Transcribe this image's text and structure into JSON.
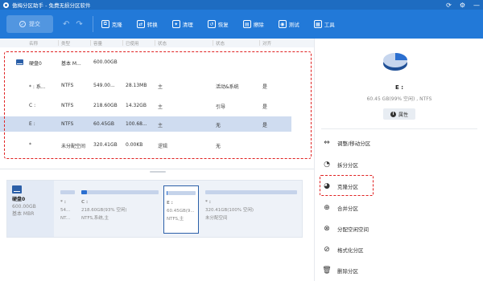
{
  "app": {
    "title": "傲梅分区助手 - 免费无损分区软件",
    "window_buttons": [
      "⟳",
      "⚙",
      "—"
    ]
  },
  "toolbar": {
    "commit_label": "提交",
    "items": [
      {
        "label": "克隆",
        "icon": "clone-icon"
      },
      {
        "label": "转换",
        "icon": "convert-icon"
      },
      {
        "label": "清理",
        "icon": "clean-icon"
      },
      {
        "label": "恢复",
        "icon": "recover-icon"
      },
      {
        "label": "擦除",
        "icon": "wipe-icon"
      },
      {
        "label": "测试",
        "icon": "test-icon"
      },
      {
        "label": "工具",
        "icon": "tools-icon"
      }
    ]
  },
  "columns": [
    "名称",
    "类型",
    "容量",
    "已使用",
    "状态",
    "状态",
    "对齐"
  ],
  "partitions": [
    {
      "name": "硬盘0",
      "type": "基本 M...",
      "capacity": "600.00GB",
      "used": "",
      "flag": "",
      "status": "",
      "align": ""
    },
    {
      "name": "* : 系...",
      "type": "NTFS",
      "capacity": "549.00...",
      "used": "28.13MB",
      "flag": "主",
      "status": "活动&系统",
      "align": "是"
    },
    {
      "name": "C :",
      "type": "NTFS",
      "capacity": "218.60GB",
      "used": "14.32GB",
      "flag": "主",
      "status": "引导",
      "align": "是"
    },
    {
      "name": "E :",
      "type": "NTFS",
      "capacity": "60.45GB",
      "used": "100.68...",
      "flag": "主",
      "status": "无",
      "align": "是"
    },
    {
      "name": "*",
      "type": "未分配空间",
      "capacity": "320.41GB",
      "used": "0.00KB",
      "flag": "逻辑",
      "status": "无",
      "align": ""
    }
  ],
  "diskmap": {
    "disk": {
      "name": "硬盘0",
      "size": "600.00GB",
      "type": "基本 MBR"
    },
    "parts": [
      {
        "name": "* :",
        "size": "54...",
        "fs": "NT...",
        "fill": 0.0
      },
      {
        "name": "C :",
        "size": "218.60GB(93% 空闲)",
        "fs": "NTFS,系统,主",
        "fill": 0.07
      },
      {
        "name": "E :",
        "size": "60.45GB(9...",
        "fs": "NTFS,主",
        "fill": 0.01
      },
      {
        "name": "* :",
        "size": "320.41GB(100% 空闲)",
        "fs": "未分配空间",
        "fill": 0.0
      }
    ]
  },
  "details": {
    "name": "E :",
    "info": "60.45 GB(99% 空闲) , NTFS",
    "properties_label": "属性"
  },
  "actions": [
    {
      "label": "调整/移动分区",
      "icon": "resize-move-icon"
    },
    {
      "label": "拆分分区",
      "icon": "split-icon"
    },
    {
      "label": "克隆分区",
      "icon": "clone-partition-icon"
    },
    {
      "label": "合并分区",
      "icon": "merge-icon"
    },
    {
      "label": "分配空闲空间",
      "icon": "allocate-space-icon"
    },
    {
      "label": "格式化分区",
      "icon": "format-icon"
    },
    {
      "label": "删除分区",
      "icon": "delete-icon"
    }
  ]
}
